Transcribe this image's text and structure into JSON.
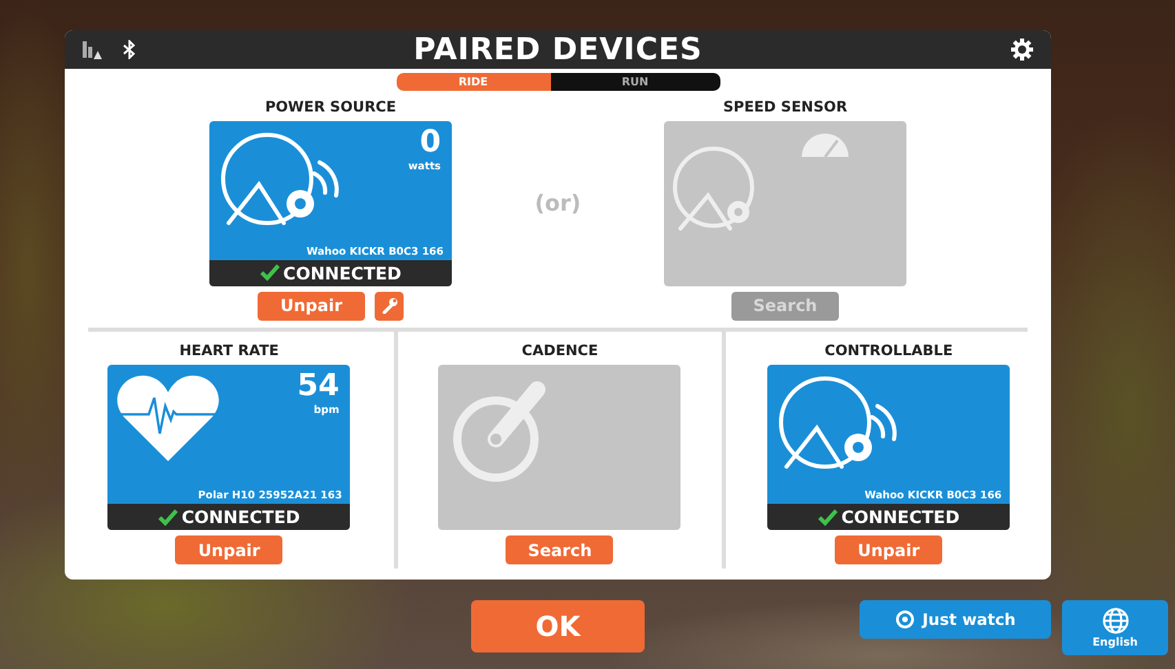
{
  "header": {
    "title": "PAIRED DEVICES"
  },
  "tabs": [
    {
      "label": "RIDE",
      "selected": true
    },
    {
      "label": "RUN",
      "selected": false
    }
  ],
  "top": {
    "separator": "(or)",
    "devices": [
      {
        "title": "POWER SOURCE",
        "kind": "trainer",
        "connected": true,
        "reading": "0",
        "unit": "watts",
        "device": "Wahoo KICKR B0C3 166",
        "status": "CONNECTED",
        "button": "Unpair",
        "button_disabled": false,
        "tool": true
      },
      {
        "title": "SPEED SENSOR",
        "kind": "speed",
        "connected": false,
        "button": "Search",
        "button_disabled": true,
        "tool": false
      }
    ]
  },
  "bottom": {
    "devices": [
      {
        "title": "HEART RATE",
        "kind": "heart",
        "connected": true,
        "reading": "54",
        "unit": "bpm",
        "device": "Polar H10 25952A21 163",
        "status": "CONNECTED",
        "button": "Unpair",
        "button_disabled": false,
        "tool": false
      },
      {
        "title": "CADENCE",
        "kind": "cadence",
        "connected": false,
        "button": "Search",
        "button_disabled": false,
        "tool": false
      },
      {
        "title": "CONTROLLABLE",
        "kind": "trainer",
        "connected": true,
        "device": "Wahoo KICKR B0C3 166",
        "status": "CONNECTED",
        "button": "Unpair",
        "button_disabled": false,
        "tool": false
      }
    ]
  },
  "footer": {
    "ok": "OK",
    "just_watch": "Just watch",
    "language": "English"
  }
}
